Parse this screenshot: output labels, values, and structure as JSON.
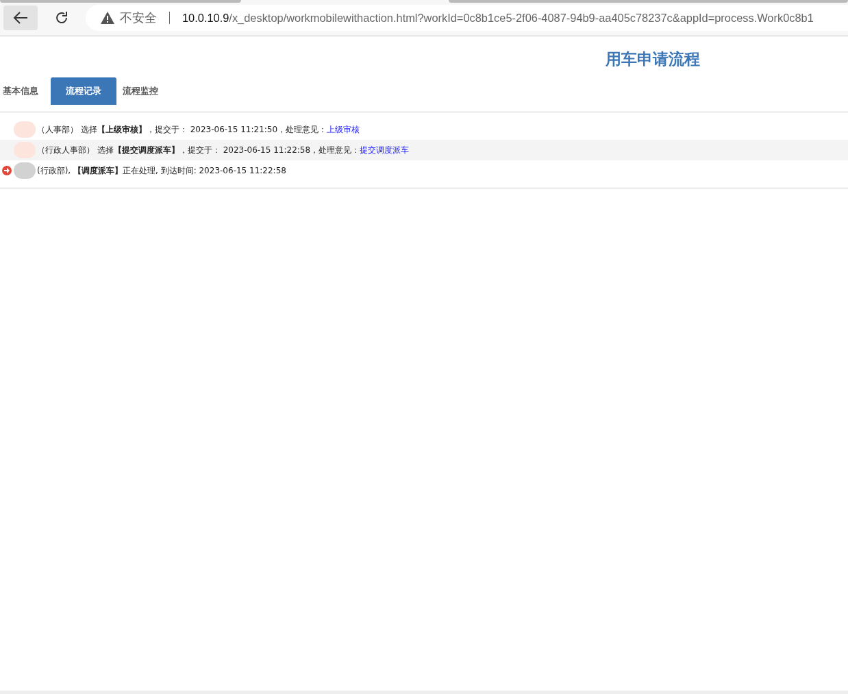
{
  "browser": {
    "security": "不安全",
    "url_host": "10.0.10.9",
    "url_rest": "/x_desktop/workmobilewithaction.html?workId=0c8b1ce5-2f06-4087-94b9-aa405c78237c&appId=process.Work0c8b1"
  },
  "page": {
    "title": "用车申请流程"
  },
  "tabs": [
    {
      "label": "基本信息",
      "selected": false
    },
    {
      "label": "流程记录",
      "selected": true
    },
    {
      "label": "流程监控",
      "selected": false
    }
  ],
  "records": [
    {
      "kind": "done",
      "text": "（人事部） 选择**【上级审核】**，提交于： 2023-06-15 11:21:50，处理意见：",
      "opinion": "上级审核"
    },
    {
      "kind": "done",
      "text": "（行政人事部） 选择**【提交调度派车】**，提交于： 2023-06-15 11:22:58，处理意见：",
      "opinion": "提交调度派车"
    },
    {
      "kind": "current",
      "text": "(行政部), **【调度派车】**正在处理, 到达时间: 2023-06-15 11:22:58"
    }
  ]
}
